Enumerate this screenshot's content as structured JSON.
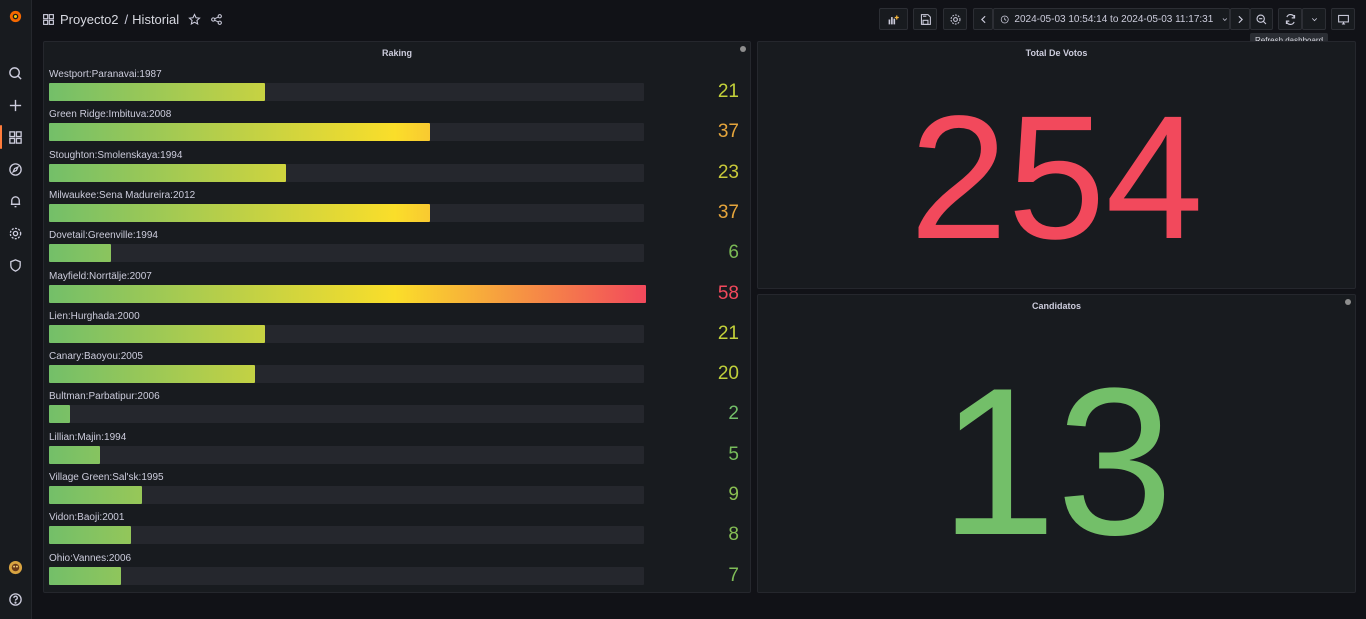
{
  "nav": {
    "folder": "Proyecto2",
    "separator": "/",
    "dashboard": "Historial"
  },
  "toolbar": {
    "time_range": "2024-05-03 10:54:14 to 2024-05-03 11:17:31",
    "tooltip": "Refresh dashboard"
  },
  "panels": {
    "raking": {
      "title": "Raking",
      "max": 58,
      "rows": [
        {
          "label": "Westport:Paranavai:1987",
          "value": 21,
          "color": "#c4d23a"
        },
        {
          "label": "Green Ridge:Imbituva:2008",
          "value": 37,
          "color": "#e5a53c"
        },
        {
          "label": "Stoughton:Smolenskaya:1994",
          "value": 23,
          "color": "#c9c93a"
        },
        {
          "label": "Milwaukee:Sena Madureira:2012",
          "value": 37,
          "color": "#e5a53c"
        },
        {
          "label": "Dovetail:Greenville:1994",
          "value": 6,
          "color": "#7bba55"
        },
        {
          "label": "Mayfield:Norrtälje:2007",
          "value": 58,
          "color": "#f2495c"
        },
        {
          "label": "Lien:Hurghada:2000",
          "value": 21,
          "color": "#c4d23a"
        },
        {
          "label": "Canary:Baoyou:2005",
          "value": 20,
          "color": "#bfcf3b"
        },
        {
          "label": "Bultman:Parbatipur:2006",
          "value": 2,
          "color": "#73bf69"
        },
        {
          "label": "Lillian:Majin:1994",
          "value": 5,
          "color": "#78bd5c"
        },
        {
          "label": "Village Green:Sal'sk:1995",
          "value": 9,
          "color": "#8abf52"
        },
        {
          "label": "Vidon:Baoji:2001",
          "value": 8,
          "color": "#85be55"
        },
        {
          "label": "Ohio:Vannes:2006",
          "value": 7,
          "color": "#80bd58"
        }
      ]
    },
    "votos": {
      "title": "Total De Votos",
      "value": "254",
      "color": "#f2495c"
    },
    "candidatos": {
      "title": "Candidatos",
      "value": "13",
      "color": "#73bf69"
    }
  },
  "colors": {
    "accent": "#ff7c3b",
    "gradient_start": "#73bf69",
    "gradient_mid": "#fade2a",
    "gradient_end": "#f2495c"
  }
}
